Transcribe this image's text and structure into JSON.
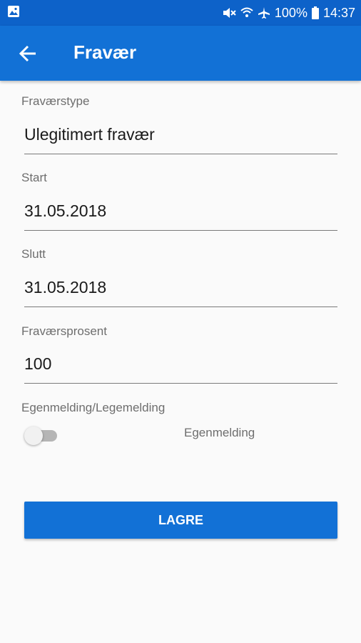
{
  "status_bar": {
    "battery_text": "100%",
    "time": "14:37",
    "icons": [
      "image-icon",
      "mute-icon",
      "wifi-icon",
      "airplane-icon",
      "battery-icon"
    ]
  },
  "app_bar": {
    "title": "Fravær",
    "back_icon": "arrow-back-icon"
  },
  "form": {
    "type": {
      "label": "Fraværstype",
      "value": "Ulegitimert fravær"
    },
    "start": {
      "label": "Start",
      "value": "31.05.2018"
    },
    "end": {
      "label": "Slutt",
      "value": "31.05.2018"
    },
    "percent": {
      "label": "Fraværsprosent",
      "value": "100"
    },
    "report": {
      "label": "Egenmelding/Legemelding",
      "toggle_text": "Egenmelding",
      "toggle_on": false
    }
  },
  "actions": {
    "save_label": "LAGRE"
  },
  "colors": {
    "primary": "#1271d6",
    "status_bar": "#0d62c9",
    "background": "#fafafa"
  }
}
